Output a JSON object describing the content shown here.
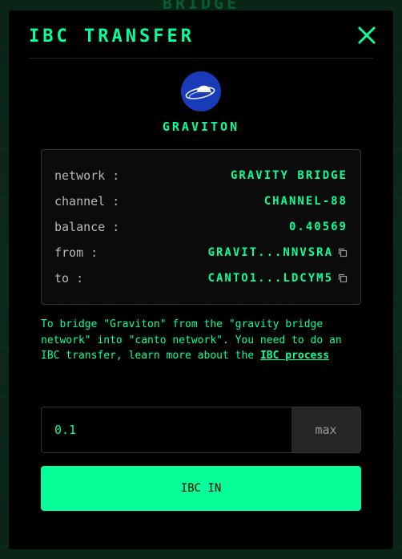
{
  "background": {
    "title": "BRIDGE"
  },
  "modal": {
    "title": "IBC TRANSFER",
    "close_icon": "close-icon"
  },
  "token": {
    "name": "GRAVITON",
    "logo_icon": "graviton-logo",
    "logo_color": "#1a3bb8"
  },
  "details": {
    "network": {
      "label": "network :",
      "value": "GRAVITY BRIDGE"
    },
    "channel": {
      "label": "channel :",
      "value": "CHANNEL-88"
    },
    "balance": {
      "label": "balance :",
      "value": "0.40569"
    },
    "from": {
      "label": "from :",
      "value": "GRAVIT...NNVSRA",
      "icon": "copy-icon"
    },
    "to": {
      "label": "to :",
      "value": "CANTO1...LDCYM5",
      "icon": "copy-icon"
    }
  },
  "notice": {
    "text": "To bridge \"Graviton\" from the \"gravity bridge network\" into \"canto network\". You need to do an IBC transfer, learn more about the ",
    "link": "IBC process"
  },
  "amount": {
    "value": "0.1",
    "max_label": "max"
  },
  "action": {
    "label": "IBC IN"
  },
  "colors": {
    "accent": "#06ff99",
    "modal_bg": "#000000",
    "card_border": "#333333",
    "label_text": "#b8b8b8"
  }
}
